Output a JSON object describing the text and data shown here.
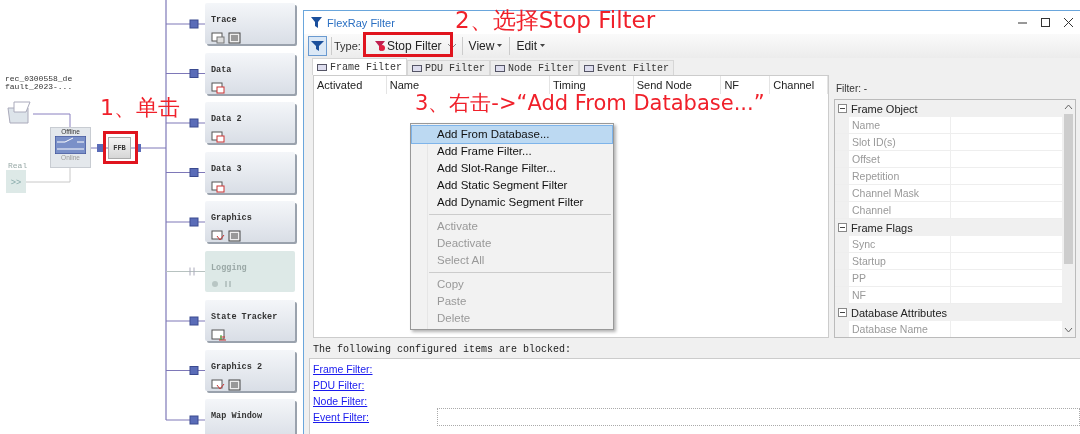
{
  "setup": {
    "source_file": "rec_0300558_default_2023-...",
    "switch_top": "Offline",
    "switch_offline": true,
    "switch_bottom": "Online",
    "real_label": "Real",
    "real_button": ">>",
    "ffb": "FFB",
    "windows": [
      {
        "title": "Trace",
        "kind": "trace",
        "disabled": false
      },
      {
        "title": "Data",
        "kind": "data",
        "disabled": false
      },
      {
        "title": "Data 2",
        "kind": "data",
        "disabled": false
      },
      {
        "title": "Data 3",
        "kind": "data",
        "disabled": false
      },
      {
        "title": "Graphics",
        "kind": "graphics",
        "disabled": false
      },
      {
        "title": "Logging",
        "kind": "logging",
        "disabled": true
      },
      {
        "title": "State Tracker",
        "kind": "state",
        "disabled": false
      },
      {
        "title": "Graphics 2",
        "kind": "graphics",
        "disabled": false
      },
      {
        "title": "Map Window",
        "kind": "map",
        "disabled": false
      }
    ]
  },
  "annotations": [
    {
      "text": "1、单击"
    },
    {
      "text": "2、选择Stop Filter"
    },
    {
      "text": "3、右击->“Add From Database...”"
    }
  ],
  "window": {
    "title": "FlexRay Filter",
    "toolbar": {
      "type_label": "Type:",
      "type_value": "Stop Filter",
      "menus": [
        "View",
        "Edit"
      ]
    },
    "tabs": [
      {
        "label": "Frame Filter",
        "selected": true
      },
      {
        "label": "PDU Filter",
        "selected": false
      },
      {
        "label": "Node Filter",
        "selected": false
      },
      {
        "label": "Event Filter",
        "selected": false
      }
    ],
    "table": {
      "columns": [
        "Activated",
        "Name",
        "Timing",
        "Send Node",
        "NF",
        "Channel"
      ]
    },
    "context_menu": [
      {
        "kind": "item",
        "label": "Add From Database...",
        "highlighted": true,
        "disabled": false
      },
      {
        "kind": "item",
        "label": "Add Frame Filter...",
        "highlighted": false,
        "disabled": false
      },
      {
        "kind": "item",
        "label": "Add Slot-Range Filter...",
        "highlighted": false,
        "disabled": false
      },
      {
        "kind": "item",
        "label": "Add Static Segment Filter",
        "highlighted": false,
        "disabled": false
      },
      {
        "kind": "item",
        "label": "Add Dynamic Segment Filter",
        "highlighted": false,
        "disabled": false
      },
      {
        "kind": "separator"
      },
      {
        "kind": "item",
        "label": "Activate",
        "highlighted": false,
        "disabled": true
      },
      {
        "kind": "item",
        "label": "Deactivate",
        "highlighted": false,
        "disabled": true
      },
      {
        "kind": "item",
        "label": "Select All",
        "highlighted": false,
        "disabled": true
      },
      {
        "kind": "separator"
      },
      {
        "kind": "item",
        "label": "Copy",
        "highlighted": false,
        "disabled": true
      },
      {
        "kind": "item",
        "label": "Paste",
        "highlighted": false,
        "disabled": true
      },
      {
        "kind": "item",
        "label": "Delete",
        "highlighted": false,
        "disabled": true
      }
    ],
    "properties": {
      "filter_label": "Filter: -",
      "groups": [
        {
          "name": "Frame Object",
          "expanded": true,
          "rows": [
            "Name",
            "Slot ID(s)",
            "Offset",
            "Repetition",
            "Channel Mask",
            "Channel"
          ]
        },
        {
          "name": "Frame Flags",
          "expanded": true,
          "rows": [
            "Sync",
            "Startup",
            "PP",
            "NF"
          ]
        },
        {
          "name": "Database Attributes",
          "expanded": true,
          "rows": [
            "Database Name"
          ]
        }
      ]
    },
    "blocked": {
      "heading": "The following configured items are blocked:",
      "links": [
        "Frame Filter:",
        "PDU Filter:",
        "Node Filter:",
        "Event Filter:"
      ]
    }
  }
}
